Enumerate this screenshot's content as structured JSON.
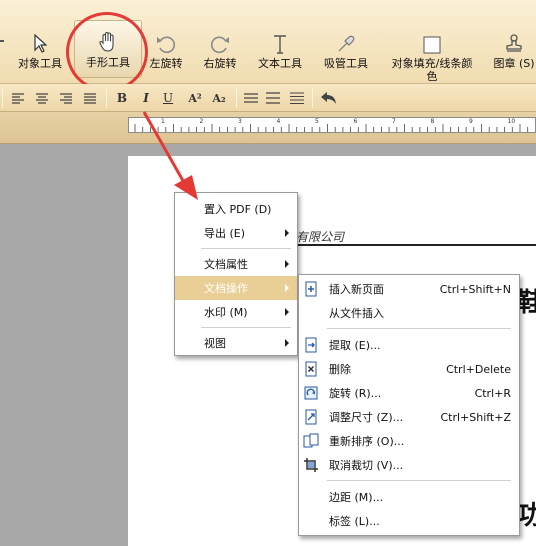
{
  "toolbar": {
    "tools": [
      {
        "label": "对象工具",
        "icon": "cursor-arrow-icon"
      },
      {
        "label": "手形工具",
        "icon": "hand-icon"
      },
      {
        "label": "左旋转",
        "icon": "rotate-left-icon"
      },
      {
        "label": "右旋转",
        "icon": "rotate-right-icon"
      },
      {
        "label": "文本工具",
        "icon": "text-tool-icon"
      },
      {
        "label": "吸管工具",
        "icon": "eyedropper-icon"
      },
      {
        "label": "对象填充/线条颜\n色",
        "icon": "fill-color-icon"
      },
      {
        "label": "图章 (S)",
        "icon": "stamp-icon"
      }
    ],
    "active_tool": "手形工具"
  },
  "formatbar": {
    "bold": "B",
    "italic": "I",
    "underline": "U",
    "superscript": "A²",
    "subscript": "A₂"
  },
  "ruler": {
    "labels": [
      "1",
      "2",
      "3",
      "4",
      "5",
      "6",
      "7",
      "8",
      "9",
      "10"
    ]
  },
  "document": {
    "company_text": "有限公司",
    "big_char_1": "鞋",
    "big_char_2": "功"
  },
  "main_menu": {
    "items": [
      {
        "label": "置入 PDF (D)",
        "submenu": false
      },
      {
        "label": "导出 (E)",
        "submenu": true
      },
      {
        "label": "文档属性",
        "submenu": true
      },
      {
        "label": "文档操作",
        "submenu": true,
        "highlighted": true
      },
      {
        "label": "水印 (M)",
        "submenu": true
      },
      {
        "label": "视图",
        "submenu": true
      }
    ]
  },
  "sub_menu": {
    "items": [
      {
        "label": "插入新页面",
        "shortcut": "Ctrl+Shift+N",
        "icon": "insert-page-icon"
      },
      {
        "label": "从文件插入",
        "shortcut": "",
        "icon": ""
      },
      {
        "label": "提取 (E)...",
        "shortcut": "",
        "icon": "extract-page-icon"
      },
      {
        "label": "删除",
        "shortcut": "Ctrl+Delete",
        "icon": "delete-page-icon"
      },
      {
        "label": "旋转 (R)...",
        "shortcut": "Ctrl+R",
        "icon": "rotate-page-icon"
      },
      {
        "label": "调整尺寸 (Z)...",
        "shortcut": "Ctrl+Shift+Z",
        "icon": "resize-page-icon"
      },
      {
        "label": "重新排序 (O)...",
        "shortcut": "",
        "icon": "reorder-pages-icon"
      },
      {
        "label": "取消裁切 (V)...",
        "shortcut": "",
        "icon": "uncrop-icon"
      },
      {
        "label": "边距 (M)...",
        "shortcut": "",
        "icon": ""
      },
      {
        "label": "标签 (L)...",
        "shortcut": "",
        "icon": ""
      }
    ]
  },
  "colors": {
    "highlight": "#e9cf95",
    "annotation_red": "#e53935",
    "toolbar_bg": "#f5e6c4"
  }
}
